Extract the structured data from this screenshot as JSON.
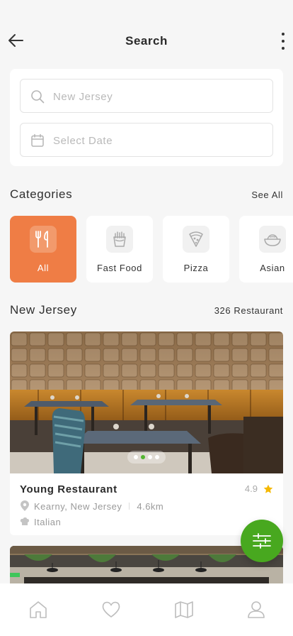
{
  "header": {
    "title": "Search",
    "back_icon": "arrow-left-icon",
    "more_icon": "more-vertical-icon"
  },
  "search": {
    "location_placeholder": "New Jersey",
    "date_placeholder": "Select Date"
  },
  "categories": {
    "heading": "Categories",
    "see_all": "See All",
    "items": [
      {
        "label": "All",
        "icon": "utensils-icon",
        "active": true
      },
      {
        "label": "Fast Food",
        "icon": "fries-icon",
        "active": false
      },
      {
        "label": "Pizza",
        "icon": "pizza-icon",
        "active": false
      },
      {
        "label": "Asian",
        "icon": "bowl-icon",
        "active": false
      }
    ]
  },
  "results": {
    "heading": "New Jersey",
    "count_label": "326 Restaurant"
  },
  "restaurant": {
    "name": "Young Restaurant",
    "rating": "4.9",
    "location": "Kearny, New Jersey",
    "distance": "4.6km",
    "cuisine": "Italian",
    "carousel_active_index": 1,
    "carousel_count": 4
  },
  "fab": {
    "icon": "filter-sliders-icon"
  },
  "bottom_nav": [
    {
      "icon": "home-icon"
    },
    {
      "icon": "heart-icon"
    },
    {
      "icon": "map-icon"
    },
    {
      "icon": "user-icon"
    }
  ],
  "colors": {
    "accent_orange": "#ef7d45",
    "accent_green": "#48a81f",
    "star": "#f5b800"
  }
}
